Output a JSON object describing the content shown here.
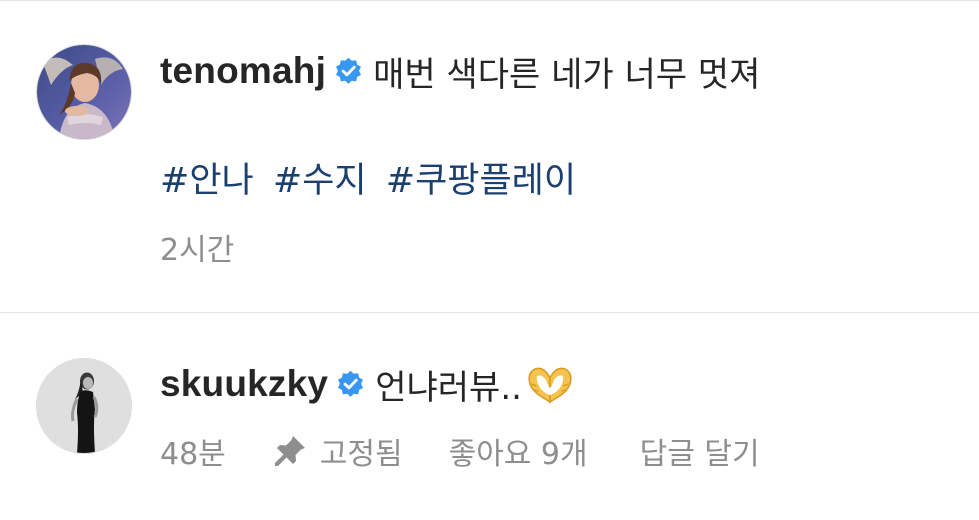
{
  "comments": [
    {
      "username": "tenomahj",
      "verified": true,
      "text": "매번 색다른 네가 너무 멋져",
      "hashtags": [
        "#안나",
        "#수지",
        "#쿠팡플레이"
      ],
      "time": "2시간"
    },
    {
      "username": "skuukzky",
      "verified": true,
      "text": "언냐러뷰..",
      "emoji_icon": "heart-hands-icon",
      "time": "48분",
      "pinned_label": "고정됨",
      "likes_label": "좋아요 9개",
      "reply_label": "답글 달기"
    }
  ],
  "colors": {
    "text": "#262626",
    "secondary": "#8e8e8e",
    "hashtag": "#1b3f6e",
    "verified": "#3897f0",
    "divider": "#e3e3e3"
  }
}
